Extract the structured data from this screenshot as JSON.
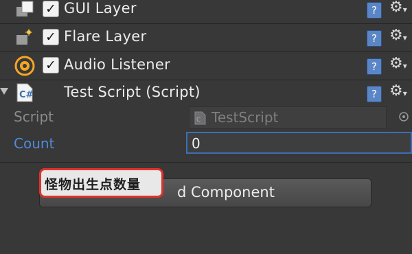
{
  "components": [
    {
      "name": "GUI Layer",
      "enabled": true,
      "icon": "gui-layer-icon"
    },
    {
      "name": "Flare Layer",
      "enabled": true,
      "icon": "flare-layer-icon"
    },
    {
      "name": "Audio Listener",
      "enabled": true,
      "icon": "audio-listener-icon"
    }
  ],
  "script_component": {
    "title": "Test Script (Script)",
    "icon": "csharp-script-icon",
    "script_label": "Script",
    "script_value": "TestScript",
    "count_label": "Count",
    "count_value": "0"
  },
  "add_component": {
    "label": "Add Component",
    "label_visible": "d Component"
  },
  "tooltip": {
    "text": "怪物出生点数量"
  },
  "colors": {
    "background": "#383838",
    "accent_blue": "#3d6fb6",
    "label_blue": "#4f8be0",
    "highlight_red": "#e0322a"
  }
}
